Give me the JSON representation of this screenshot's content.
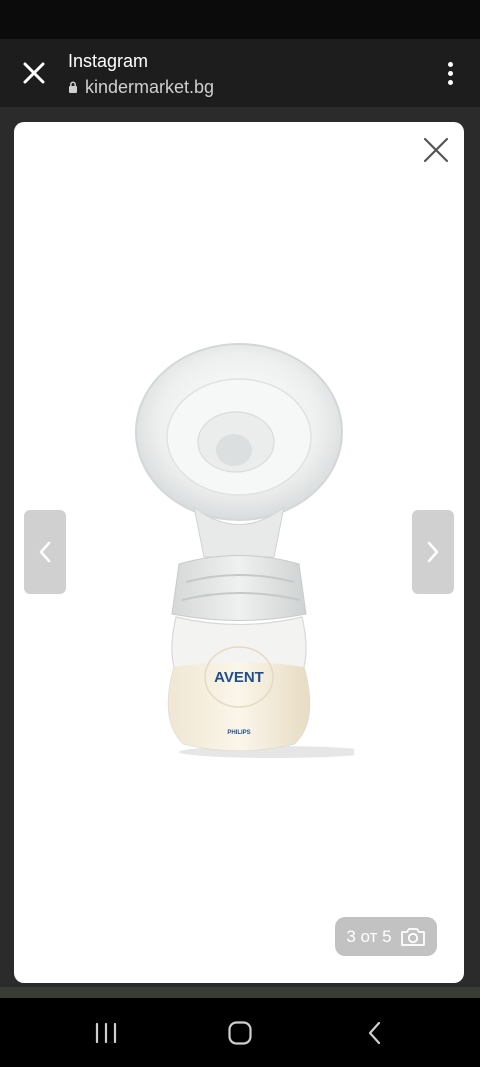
{
  "browser": {
    "title": "Instagram",
    "url": "kindermarket.bg"
  },
  "gallery": {
    "counter": "3 от 5",
    "current_index": 3,
    "total": 5
  },
  "product_image": {
    "brand_label": "AVENT",
    "sub_brand_label": "PHILIPS"
  },
  "colors": {
    "browser_bar": "#1d1d1d",
    "counter_bg": "#c2c2c2",
    "arrow_bg": "#d0d0d0"
  },
  "icons": {
    "close": "close-icon",
    "lock": "lock-icon",
    "menu": "more-vert-icon",
    "modal_close": "close-icon",
    "prev": "chevron-left-icon",
    "next": "chevron-right-icon",
    "camera": "camera-icon",
    "recents": "recents-icon",
    "home": "home-icon",
    "back": "back-icon"
  }
}
